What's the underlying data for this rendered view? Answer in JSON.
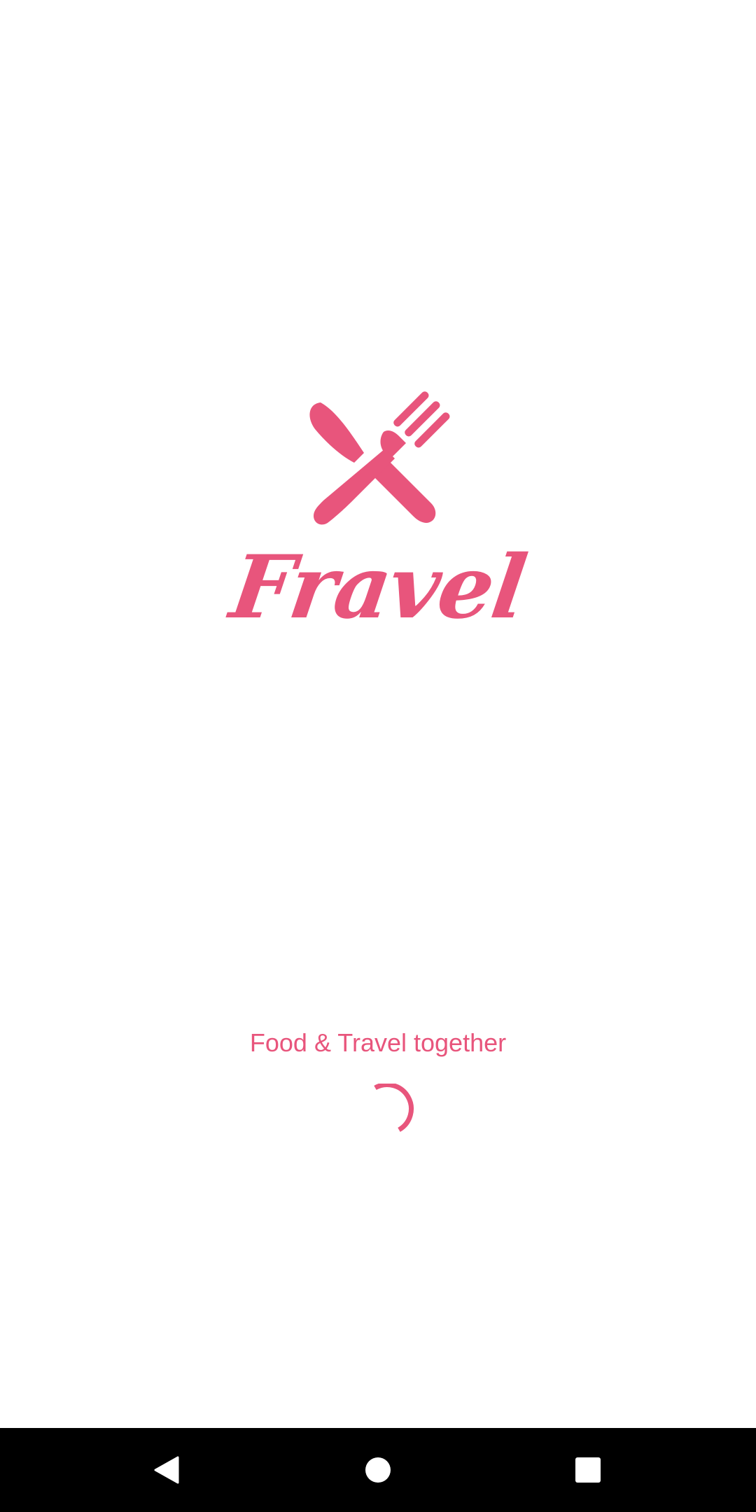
{
  "app": {
    "name": "Fravel",
    "tagline": "Food & Travel together",
    "logo_icon": "fork-knife-icon"
  },
  "colors": {
    "accent": "#E8557C",
    "background": "#FFFFFF",
    "nav_bar": "#000000",
    "nav_icon": "#FFFFFF"
  },
  "loading": {
    "indicator": "progress-spinner-icon"
  },
  "navigation": {
    "back_icon": "back-triangle-icon",
    "home_icon": "home-circle-icon",
    "recents_icon": "recents-square-icon"
  }
}
